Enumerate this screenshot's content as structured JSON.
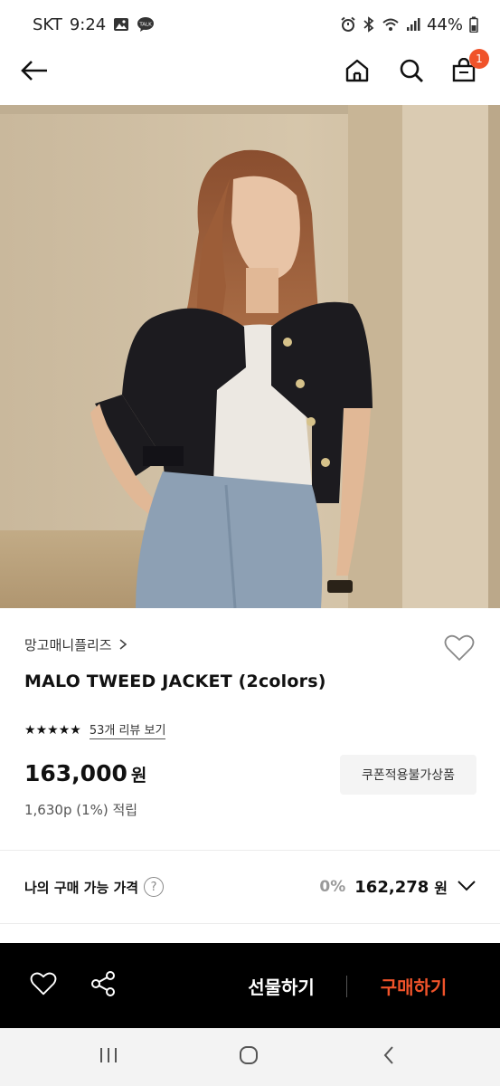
{
  "status_bar": {
    "carrier": "SKT",
    "time": "9:24",
    "battery": "44%",
    "left_icons": [
      "gallery-icon",
      "kakaotalk-icon"
    ],
    "right_icons": [
      "alarm-icon",
      "bluetooth-icon",
      "wifi-icon",
      "signal-icon",
      "battery-icon"
    ]
  },
  "nav": {
    "cart_count": "1",
    "icons": [
      "back-arrow-icon",
      "home-icon",
      "search-icon",
      "cart-icon"
    ]
  },
  "product": {
    "brand": "망고매니플리즈",
    "name": "MALO TWEED JACKET (2colors)",
    "rating_stars": 5,
    "review_link": "53개 리뷰 보기",
    "price": "163,000",
    "price_unit": "원",
    "coupon_label": "쿠폰적용불가상품",
    "points": "1,630p (1%) 적립"
  },
  "my_price": {
    "label": "나의 구매 가능 가격",
    "discount": "0%",
    "price": "162,278",
    "unit": "원"
  },
  "buy_bar": {
    "gift_label": "선물하기",
    "purchase_label": "구매하기"
  },
  "colors": {
    "accent": "#f0532a",
    "buy_bar_bg": "#000000"
  }
}
